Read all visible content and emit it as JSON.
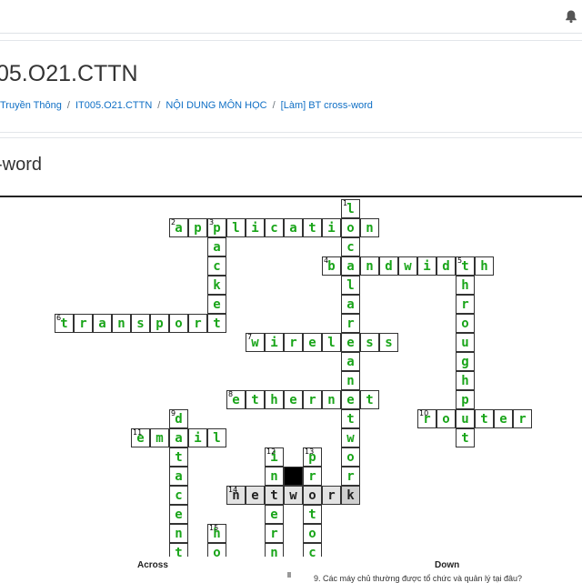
{
  "course": {
    "title": "05.O21.CTTN"
  },
  "breadcrumb": [
    "Truyền Thông",
    "IT005.O21.CTTN",
    "NỘI DUNG MÔN HỌC",
    "[Làm] BT cross-word"
  ],
  "activity": {
    "title": "-word"
  },
  "crossword": {
    "words": [
      {
        "number": 2,
        "dir": "across",
        "row": 1,
        "col": 9,
        "answer": "application"
      },
      {
        "number": 4,
        "dir": "across",
        "row": 3,
        "col": 17,
        "answer": "bandwidth"
      },
      {
        "number": 6,
        "dir": "across",
        "row": 6,
        "col": 3,
        "answer": "transport"
      },
      {
        "number": 7,
        "dir": "across",
        "row": 7,
        "col": 13,
        "answer": "wireless"
      },
      {
        "number": 8,
        "dir": "across",
        "row": 10,
        "col": 12,
        "answer": "ethernet"
      },
      {
        "number": 10,
        "dir": "across",
        "row": 11,
        "col": 22,
        "answer": "router"
      },
      {
        "number": 11,
        "dir": "across",
        "row": 12,
        "col": 7,
        "answer": "email"
      },
      {
        "number": 14,
        "dir": "across",
        "row": 15,
        "col": 12,
        "answer": "network"
      },
      {
        "number": 1,
        "dir": "down",
        "row": 0,
        "col": 18,
        "answer": "localareanetwork"
      },
      {
        "number": 3,
        "dir": "down",
        "row": 1,
        "col": 11,
        "answer": "packet"
      },
      {
        "number": 5,
        "dir": "down",
        "row": 3,
        "col": 24,
        "answer": "throughput"
      },
      {
        "number": 9,
        "dir": "down",
        "row": 11,
        "col": 9,
        "answer": "datacenter"
      },
      {
        "number": 12,
        "dir": "down",
        "row": 13,
        "col": 14,
        "answer": "internet"
      },
      {
        "number": 13,
        "dir": "down",
        "row": 13,
        "col": 16,
        "answer": "protocol"
      },
      {
        "number": 15,
        "dir": "down",
        "row": 17,
        "col": 11,
        "answer": "host"
      }
    ],
    "black_cells": [
      {
        "row": 14,
        "col": 15
      }
    ],
    "highlighted_word": 14,
    "cursor": {
      "row": 15,
      "col": 18
    }
  },
  "clues": {
    "across_label": "Across",
    "down_label": "Down",
    "down_first_clue": "9. Các máy chủ thường được tổ chức và quản lý tại đâu?"
  },
  "colors": {
    "answer_letter": "#1aa51a",
    "link": "#0f6fc5",
    "highlight": "#e3e3e3"
  }
}
